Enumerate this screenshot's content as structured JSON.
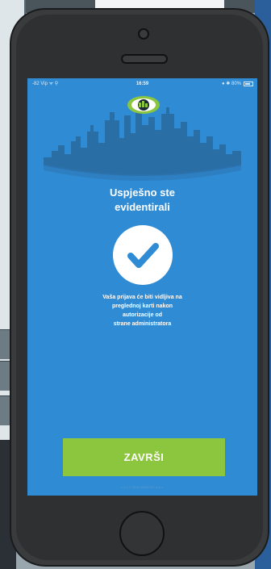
{
  "statusbar": {
    "carrier": "-82 Vip ᯤ ⚲",
    "time": "16:59",
    "right": "● ✱ 80%"
  },
  "screen": {
    "title_line1": "Uspješno ste",
    "title_line2": "evidentirali",
    "message_line1": "Vaša prijava će biti vidljiva na",
    "message_line2": "preglednoj karti nakon",
    "message_line3": "autorizacije od",
    "message_line4": "strane administratora",
    "finish_label": "ZAVRŠI",
    "version": "v 1.2 © 2016 MANUNIT d.o.o."
  },
  "colors": {
    "screen_bg": "#2f8bd3",
    "accent_green": "#8cc63e",
    "check_blue": "#2f8bd3",
    "logo_green": "#8cc63e"
  },
  "icons": [
    "camera-icon",
    "speaker-icon",
    "battery-icon",
    "eye-logo-icon",
    "check-icon",
    "home-button"
  ]
}
